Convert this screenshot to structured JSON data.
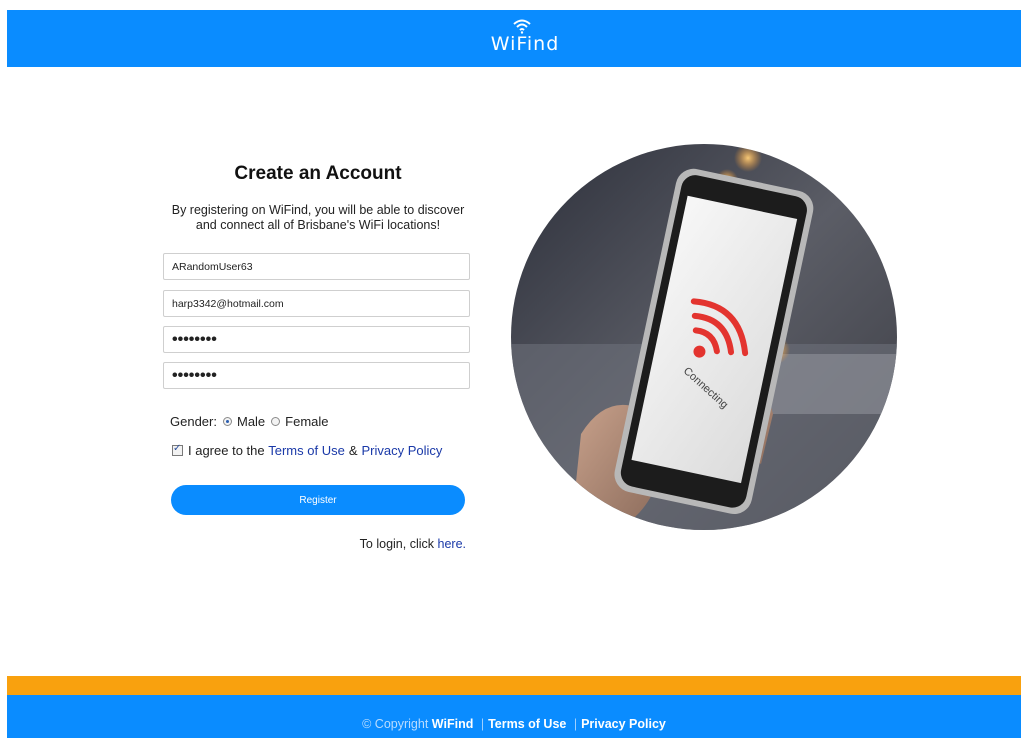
{
  "header": {
    "logo_text": "WiFind",
    "logo_icon": "wifi-icon"
  },
  "form": {
    "title": "Create an Account",
    "subtitle_line1": "By registering on WiFind, you will be able to discover",
    "subtitle_line2": "and connect all of Brisbane's WiFi locations!",
    "username_value": "ARandomUser63",
    "email_value": "harp3342@hotmail.com",
    "password_value": "••••••••",
    "confirm_password_value": "••••••••",
    "gender_label": "Gender:",
    "gender_options": [
      "Male",
      "Female"
    ],
    "gender_selected": "Male",
    "agree_checked": true,
    "agree_text": "I agree to the",
    "terms_link": "Terms of Use",
    "amp": "&",
    "privacy_link": "Privacy Policy",
    "register_label": "Register",
    "login_text": "To login, click",
    "login_link": "here."
  },
  "photo": {
    "screen_text": "Connecting",
    "wifi_color": "#e3342f"
  },
  "footer": {
    "copyright": "© Copyright",
    "brand": "WiFind",
    "sep": "|",
    "terms": "Terms of Use",
    "privacy": "Privacy Policy"
  },
  "colors": {
    "primary": "#0a8cff",
    "accent": "#f9a10e",
    "link": "#1a39a8"
  }
}
